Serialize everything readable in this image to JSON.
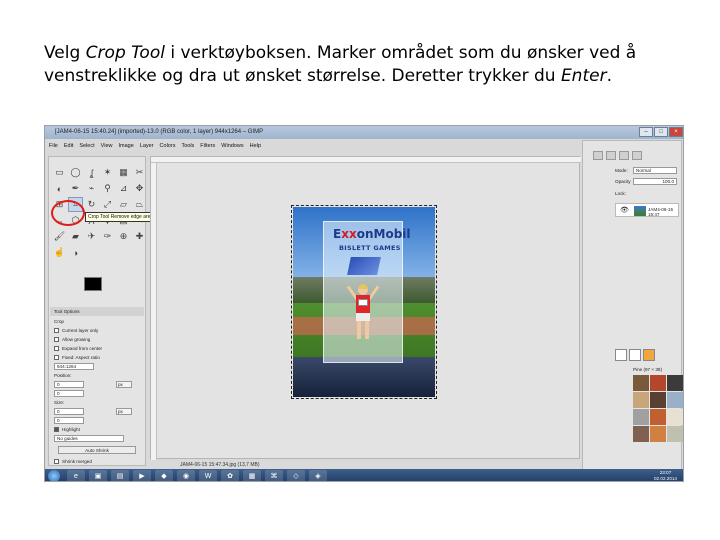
{
  "caption": {
    "part1": "Velg ",
    "tool_name": "Crop Tool",
    "part2": " i verktøyboksen. Marker området som du ønsker ved å venstreklikke og dra ut ønsket størrelse. Deretter trykker du ",
    "key_name": "Enter",
    "part3": "."
  },
  "window": {
    "title": "[JAM4-06-15 15:40.24] (imported)-13.0 (RGB color, 1 layer) 944x1264 – GIMP",
    "menus": [
      "File",
      "Edit",
      "Select",
      "View",
      "Image",
      "Layer",
      "Colors",
      "Tools",
      "Filters",
      "Windows",
      "Help"
    ]
  },
  "toolbox": {
    "tooltip": "Crop Tool  Remove edge areas from image or layer  Shift+C",
    "options_tab": "Tool Options",
    "crop_heading": "Crop",
    "current_layer_only": "Current layer only",
    "allow_growing": "Allow growing",
    "expand_from_center": "Expand from center",
    "fixed": "Fixed: Aspect ratio",
    "fixed_value": "944:1264",
    "position_label": "Position:",
    "position_x": "0",
    "position_y": "0",
    "size_label": "Size:",
    "size_w": "0",
    "size_h": "0",
    "unit": "px",
    "highlight": "Highlight",
    "guides": "No guides",
    "auto_shrink": "Auto Shrink",
    "shrink_merged": "Shrink merged"
  },
  "canvas": {
    "logo_main": "ExxonMobil",
    "logo_sub": "BISLETT GAMES",
    "statusbar": "JAM4-06-15 15:47.34.jpg (13,7 MB)"
  },
  "dock": {
    "mode_label": "Mode:",
    "mode_value": "Normal",
    "opacity_label": "Opacity",
    "opacity_value": "100.0",
    "lock_label": "Lock:",
    "layer_name": "JAM4-06-15 15:47",
    "pattern_label": "Pine (97 × 38)"
  },
  "taskbar": {
    "time": "23:07",
    "date": "02.02.2014"
  },
  "colors": {
    "highlight_ring": "#e01b1b",
    "tooltip_bg": "#ffffe1",
    "exxon_red": "#d31d1d",
    "exxon_blue": "#1b3b8b"
  }
}
